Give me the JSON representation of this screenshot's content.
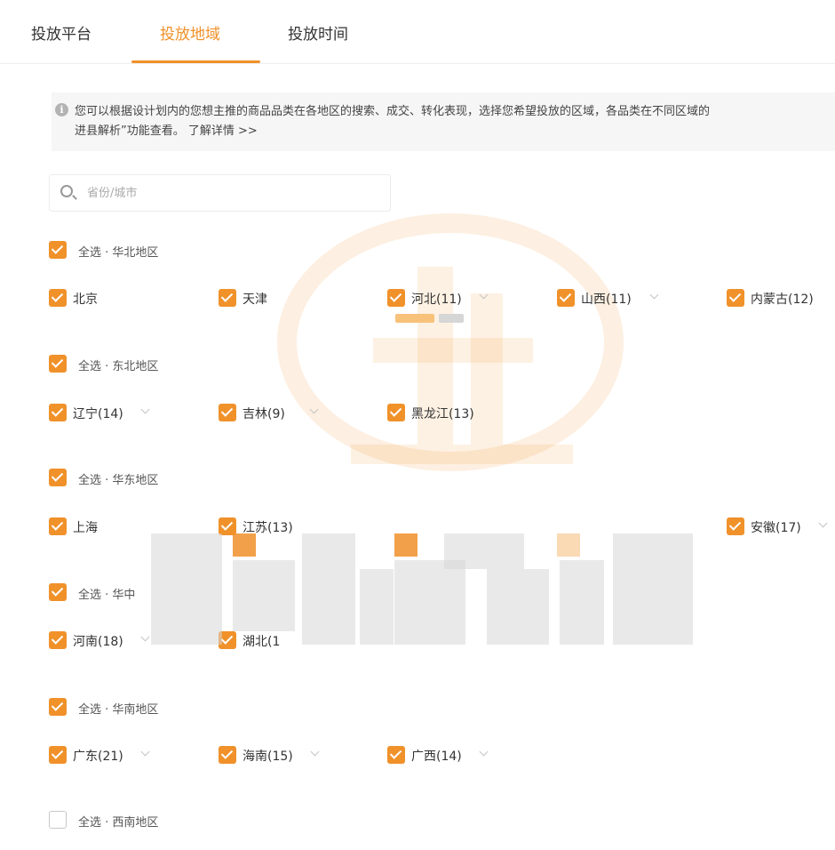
{
  "tabs": [
    {
      "label": "投放平台",
      "active": false
    },
    {
      "label": "投放地域",
      "active": true
    },
    {
      "label": "投放时间",
      "active": false
    }
  ],
  "notice": {
    "icon": "info-icon",
    "line1": "您可以根据设计划内的您想主推的商品品类在各地区的搜索、成交、转化表现，选择您希望投放的区域，各品类在不同区域的",
    "line2": "进县解析”功能查看。",
    "learn_more": "了解详情 >>"
  },
  "search": {
    "placeholder": "省份/城市",
    "value": ""
  },
  "regions": [
    {
      "select_all_label": "全选 · 华北地区",
      "checked": true,
      "items": [
        {
          "label": "北京",
          "checked": true,
          "expandable": false
        },
        {
          "label": "天津",
          "checked": true,
          "expandable": false
        },
        {
          "label": "河北(11)",
          "checked": true,
          "expandable": true
        },
        {
          "label": "山西(11)",
          "checked": true,
          "expandable": true
        },
        {
          "label": "内蒙古(12)",
          "checked": true,
          "expandable": true
        }
      ]
    },
    {
      "select_all_label": "全选 · 东北地区",
      "checked": true,
      "items": [
        {
          "label": "辽宁(14)",
          "checked": true,
          "expandable": true
        },
        {
          "label": "吉林(9)",
          "checked": true,
          "expandable": true
        },
        {
          "label": "黑龙江(13)",
          "checked": true,
          "expandable": true
        }
      ]
    },
    {
      "select_all_label": "全选 · 华东地区",
      "checked": true,
      "items": [
        {
          "label": "上海",
          "checked": true,
          "expandable": false
        },
        {
          "label": "江苏(13)",
          "checked": true,
          "expandable": true
        },
        {
          "label": "",
          "checked": true,
          "expandable": true
        },
        {
          "label": "",
          "checked": true,
          "expandable": true
        },
        {
          "label": "安徽(17)",
          "checked": true,
          "expandable": true
        }
      ]
    },
    {
      "select_all_label": "全选 · 华中",
      "checked": true,
      "items": [
        {
          "label": "河南(18)",
          "checked": true,
          "expandable": true
        },
        {
          "label": "湖北(1",
          "checked": true,
          "expandable": true
        }
      ]
    },
    {
      "select_all_label": "全选 · 华南地区",
      "checked": true,
      "items": [
        {
          "label": "广东(21)",
          "checked": true,
          "expandable": true
        },
        {
          "label": "海南(15)",
          "checked": true,
          "expandable": true
        },
        {
          "label": "广西(14)",
          "checked": true,
          "expandable": true
        }
      ]
    },
    {
      "select_all_label": "全选 · 西南地区",
      "checked": false,
      "items": []
    }
  ],
  "colors": {
    "accent": "#f0912a",
    "text": "#333333",
    "notice_bg": "#f6f6f6"
  }
}
